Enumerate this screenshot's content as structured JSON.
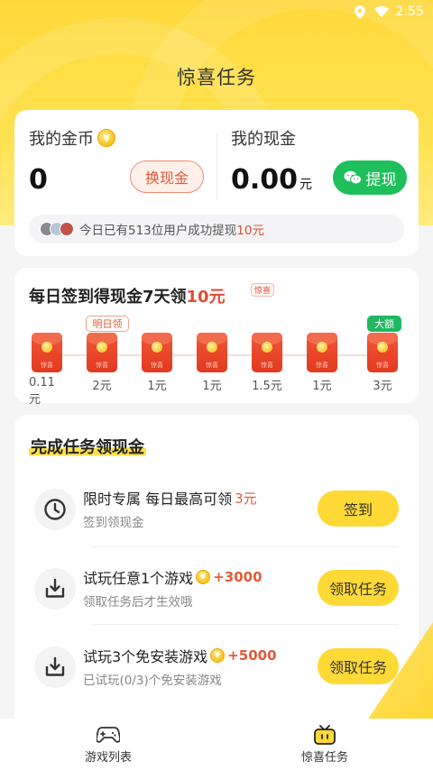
{
  "status_bar": {
    "time": "2:55",
    "icons": [
      "location-icon",
      "wifi-icon"
    ]
  },
  "page": {
    "title": "惊喜任务"
  },
  "wallet": {
    "coins_label": "我的金币",
    "coins_value": "0",
    "exchange_label": "换现金",
    "cash_label": "我的现金",
    "cash_value": "0.00",
    "cash_unit": "元",
    "withdraw_label": "提现",
    "notice_prefix": "今日已有513位用户成功提现",
    "notice_amount": "10元"
  },
  "signin": {
    "title_prefix": "每日签到得现金7天领",
    "title_amount": "10元",
    "title_tag": "惊喜",
    "badge_tomorrow": "明日领",
    "badge_big": "大额",
    "days": [
      {
        "amount": "0.11元",
        "packet_text": "惊喜"
      },
      {
        "amount": "2元",
        "packet_text": "惊喜"
      },
      {
        "amount": "1元",
        "packet_text": "惊喜"
      },
      {
        "amount": "1元",
        "packet_text": "惊喜"
      },
      {
        "amount": "1.5元",
        "packet_text": "惊喜"
      },
      {
        "amount": "1元",
        "packet_text": "惊喜"
      },
      {
        "amount": "3元",
        "packet_text": "惊喜"
      }
    ]
  },
  "tasks": {
    "title": "完成任务领现金",
    "items": [
      {
        "title": "限时专属 每日最高可领",
        "reward": "3元",
        "subtitle": "签到领现金",
        "button": "签到",
        "icon": "clock-icon"
      },
      {
        "title": "试玩任意1个游戏",
        "reward": "+3000",
        "subtitle": "领取任务后才生效哦",
        "button": "领取任务",
        "icon": "download-icon"
      },
      {
        "title": "试玩3个免安装游戏",
        "reward": "+5000",
        "subtitle": "已试玩(0/3)个免安装游戏",
        "button": "领取任务",
        "icon": "download-icon"
      }
    ]
  },
  "nav": {
    "items": [
      {
        "label": "游戏列表",
        "icon": "gamepad-icon"
      },
      {
        "label": "惊喜任务",
        "icon": "gift-tv-icon"
      }
    ]
  },
  "colors": {
    "brand_yellow": "#ffd935",
    "reward_red": "#e05a3a",
    "withdraw_green": "#1fbf5b"
  }
}
